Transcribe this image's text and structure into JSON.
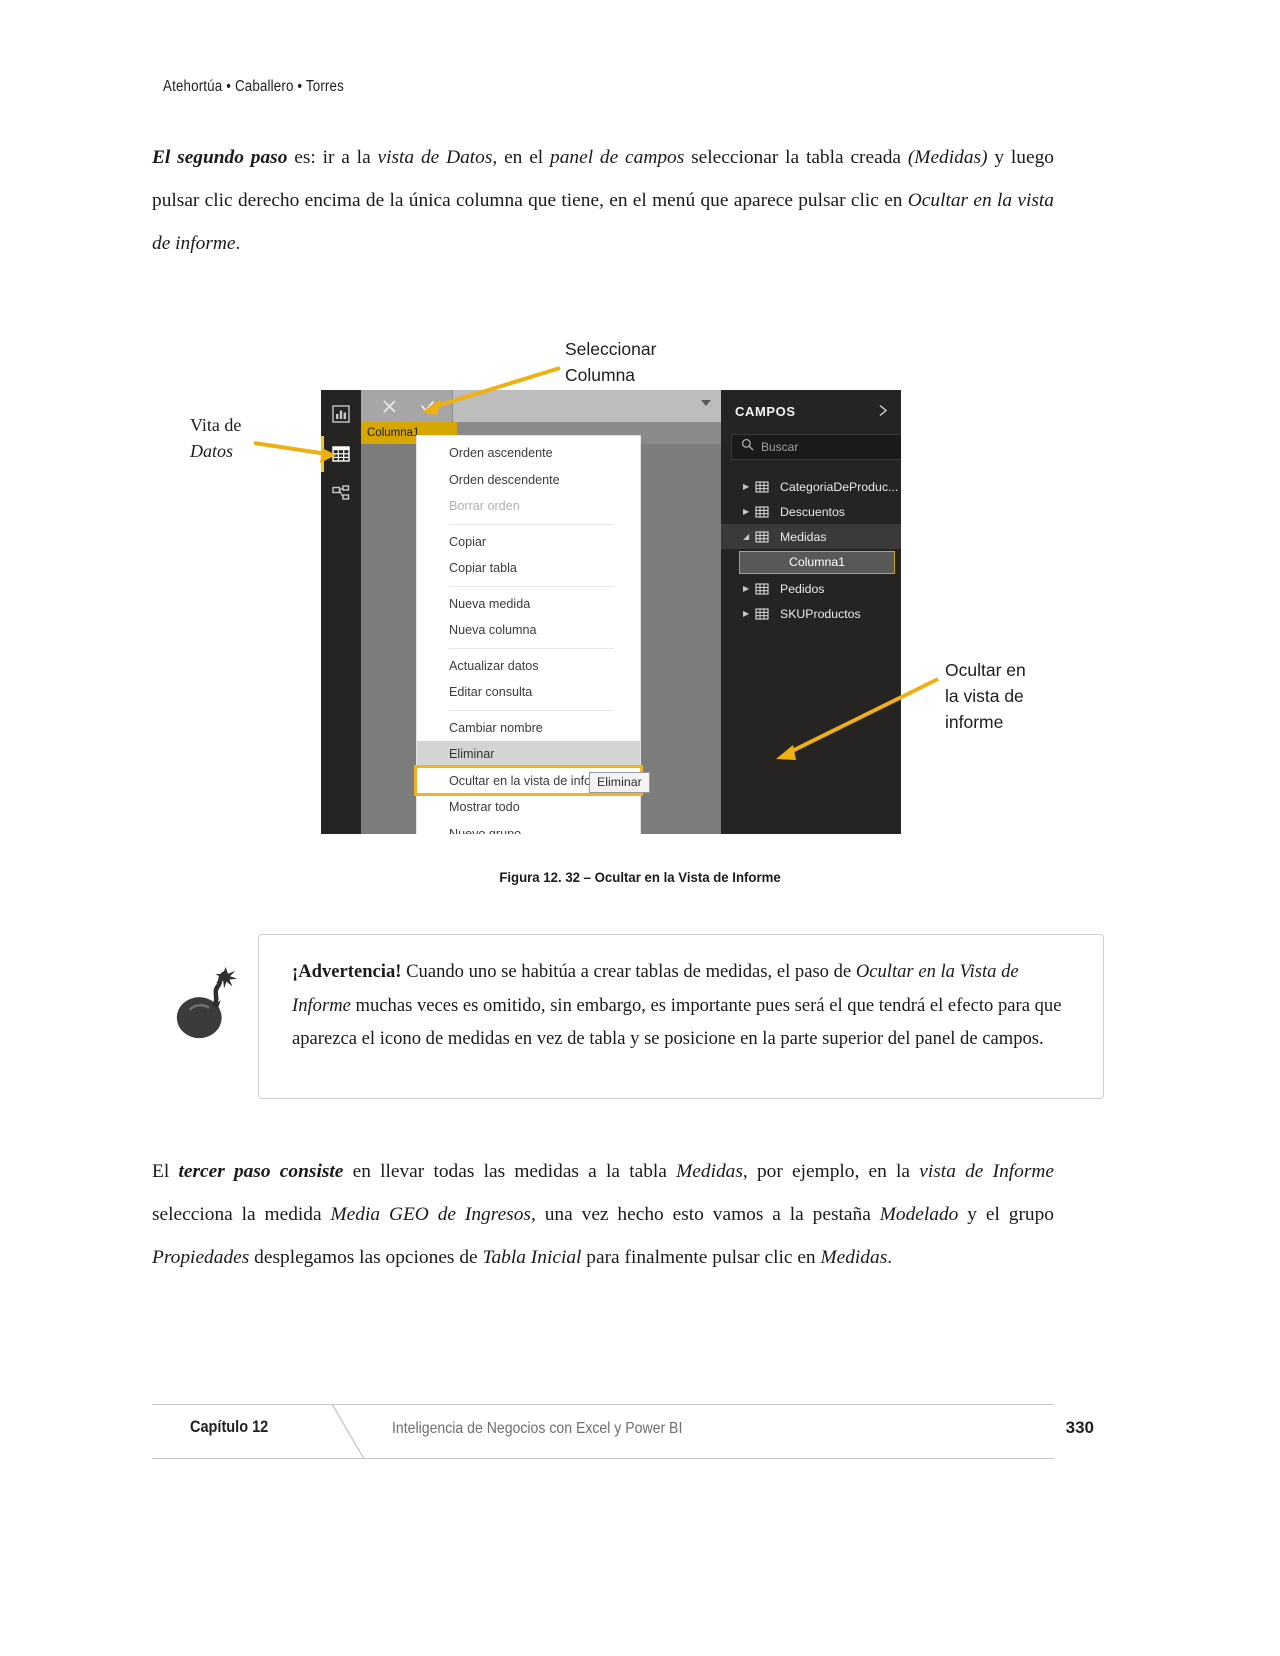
{
  "header": {
    "running_head": "Atehortúa • Caballero • Torres"
  },
  "paragraphs": {
    "p1_parts": {
      "bold_italic": "El segundo paso",
      "t1": " es: ir a la ",
      "i1": "vista de Datos",
      "t2": ", en el ",
      "i2": "panel de campos",
      "t3": " seleccionar la tabla creada ",
      "i3": "(Medidas)",
      "t4": " y luego pulsar clic derecho encima de la única columna que tiene, en el menú que aparece pulsar clic en ",
      "i4": "Ocultar en la vista de informe",
      "t5": "."
    },
    "p3_parts": {
      "t0": "El ",
      "bi1": "tercer paso consiste",
      "t1": " en llevar todas las medidas a la tabla ",
      "i1": "Medidas",
      "t2": ", por ejemplo, en la ",
      "i2": "vista de Informe",
      "t3": " selecciona la medida ",
      "i3": "Media GEO de Ingresos,",
      "t4": " una vez hecho esto vamos a la pestaña ",
      "i4": "Modelado",
      "t5": " y el grupo ",
      "i5": "Propiedades",
      "t6": " desplegamos las opciones de ",
      "i6": "Tabla Inicial",
      "t7": " para finalmente pulsar clic en ",
      "i7": "Medidas",
      "t8": "."
    }
  },
  "annotations": {
    "seleccionar_columna": "Seleccionar\nColumna",
    "seleccionar_columna_line1": "Seleccionar",
    "seleccionar_columna_line2": "Columna",
    "vista_datos_line1": "Vita de",
    "vista_datos_line2": "Datos",
    "ocultar_line1": "Ocultar en",
    "ocultar_line2": "la vista de",
    "ocultar_line3": "informe",
    "accent_color": "#eeb111"
  },
  "screenshot": {
    "nav_icons": [
      "report-view-icon",
      "data-view-icon",
      "model-view-icon"
    ],
    "selected_nav": "data-view-icon",
    "formula_bar": {
      "cancel_label": "✕",
      "accept_label": "✓",
      "value": ""
    },
    "grid": {
      "column_header": "Columna1"
    },
    "context_menu": {
      "items": [
        {
          "label": "Orden ascendente",
          "state": "normal",
          "separator_after": false
        },
        {
          "label": "Orden descendente",
          "state": "normal",
          "separator_after": false
        },
        {
          "label": "Borrar orden",
          "state": "disabled",
          "separator_after": true
        },
        {
          "label": "Copiar",
          "state": "normal",
          "separator_after": false
        },
        {
          "label": "Copiar tabla",
          "state": "normal",
          "separator_after": true
        },
        {
          "label": "Nueva medida",
          "state": "normal",
          "separator_after": false
        },
        {
          "label": "Nueva columna",
          "state": "normal",
          "separator_after": true
        },
        {
          "label": "Actualizar datos",
          "state": "normal",
          "separator_after": false
        },
        {
          "label": "Editar consulta",
          "state": "normal",
          "separator_after": true
        },
        {
          "label": "Cambiar nombre",
          "state": "normal",
          "separator_after": false
        },
        {
          "label": "Eliminar",
          "state": "hover",
          "separator_after": false
        },
        {
          "label": "Ocultar en la vista de informe",
          "state": "highlighted",
          "separator_after": false
        },
        {
          "label": "Mostrar todo",
          "state": "normal",
          "separator_after": false
        },
        {
          "label": "Nuevo grupo",
          "state": "normal",
          "separator_after": false
        }
      ],
      "tooltip": "Eliminar"
    },
    "campos_panel": {
      "title": "CAMPOS",
      "collapse_icon": "chevron-right-icon",
      "search_placeholder": "Buscar",
      "fields": [
        {
          "label": "CategoriaDeProduc...",
          "expanded": false,
          "selected": false
        },
        {
          "label": "Descuentos",
          "expanded": false,
          "selected": false
        },
        {
          "label": "Medidas",
          "expanded": true,
          "selected": true
        },
        {
          "label": "Pedidos",
          "expanded": false,
          "selected": false
        },
        {
          "label": "SKUProductos",
          "expanded": false,
          "selected": false
        }
      ],
      "child_field": "Columna1"
    }
  },
  "figure": {
    "caption": "Figura 12. 32 – Ocultar en la Vista de Informe"
  },
  "warning": {
    "icon": "bomb-icon",
    "parts": {
      "b1": "¡Advertencia!",
      "t1": " Cuando uno se habitúa a crear tablas de medidas, el paso de ",
      "i1": "Ocultar en la Vista de Informe",
      "t2": " muchas veces es omitido, sin embargo, es importante pues será el que tendrá el efecto para que aparezca el icono de medidas en vez de tabla y se posicione en la parte superior del panel de campos."
    }
  },
  "footer": {
    "chapter": "Capítulo 12",
    "book_title": "Inteligencia de Negocios con Excel y Power BI",
    "page_number": "330"
  }
}
